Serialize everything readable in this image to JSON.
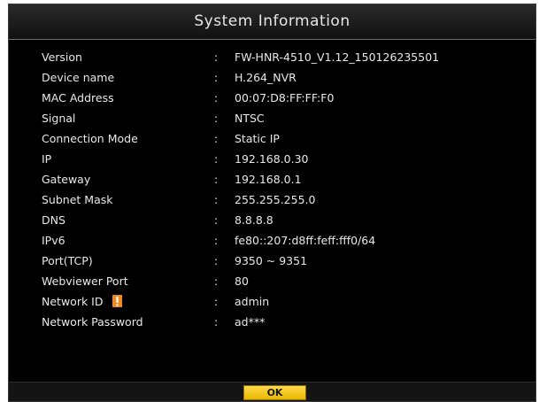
{
  "dialog": {
    "title": "System Information",
    "ok_label": "OK"
  },
  "rows": [
    {
      "label": "Version",
      "value": "FW-HNR-4510_V1.12_150126235501"
    },
    {
      "label": "Device name",
      "value": "H.264_NVR"
    },
    {
      "label": "MAC Address",
      "value": "00:07:D8:FF:FF:F0"
    },
    {
      "label": "Signal",
      "value": "NTSC"
    },
    {
      "label": "Connection Mode",
      "value": "Static IP"
    },
    {
      "label": "IP",
      "value": "192.168.0.30"
    },
    {
      "label": "Gateway",
      "value": "192.168.0.1"
    },
    {
      "label": "Subnet Mask",
      "value": "255.255.255.0"
    },
    {
      "label": "DNS",
      "value": "8.8.8.8"
    },
    {
      "label": "IPv6",
      "value": "fe80::207:d8ff:feff:fff0/64"
    },
    {
      "label": "Port(TCP)",
      "value": "9350 ~ 9351"
    },
    {
      "label": "Webviewer Port",
      "value": "80"
    },
    {
      "label": "Network ID",
      "value": "admin",
      "icon": "warning-icon"
    },
    {
      "label": "Network Password",
      "value": "ad***"
    }
  ],
  "separator": ":",
  "colors": {
    "background": "#000000",
    "text": "#e8e8e8",
    "ok_button": "#f5c400",
    "warning_icon": "#f08a1c"
  }
}
